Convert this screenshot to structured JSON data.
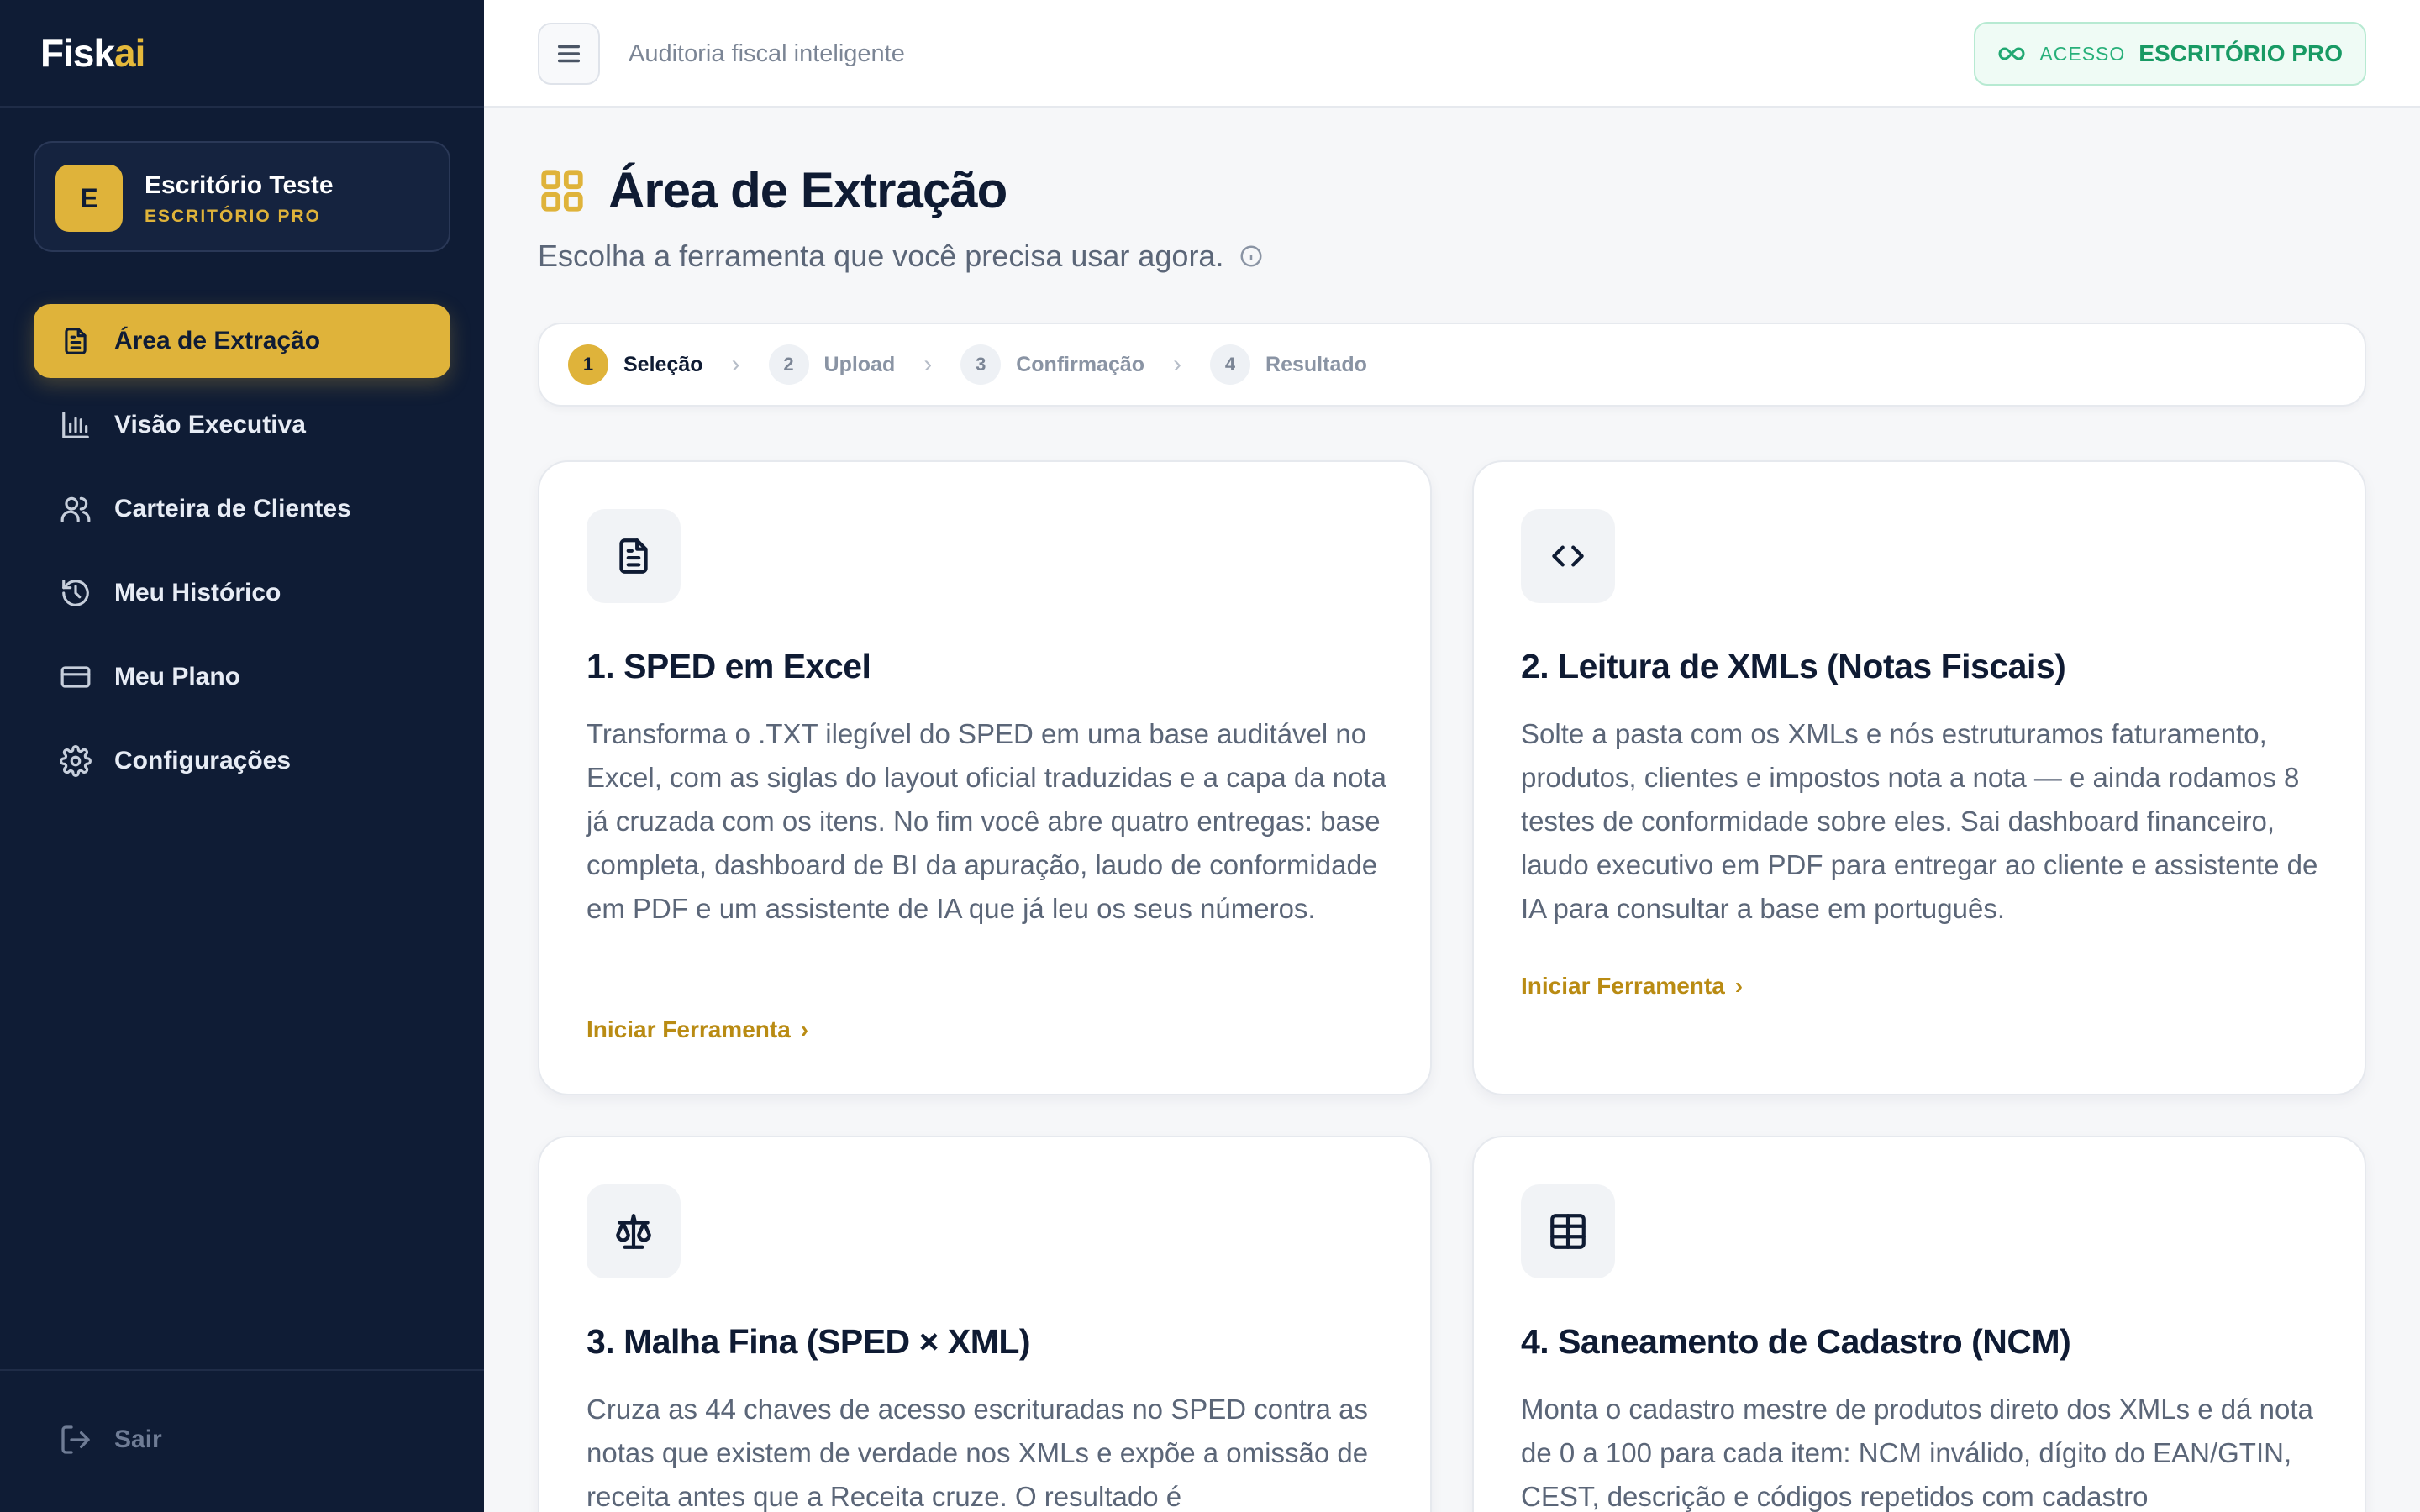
{
  "brand": {
    "name_main": "Fisk",
    "name_accent": "ai"
  },
  "account": {
    "initial": "E",
    "name": "Escritório Teste",
    "plan": "ESCRITÓRIO PRO"
  },
  "nav": [
    {
      "label": "Área de Extração",
      "icon": "file-text-icon",
      "active": true
    },
    {
      "label": "Visão Executiva",
      "icon": "bar-chart-icon"
    },
    {
      "label": "Carteira de Clientes",
      "icon": "users-icon"
    },
    {
      "label": "Meu Histórico",
      "icon": "history-icon"
    },
    {
      "label": "Meu Plano",
      "icon": "credit-card-icon"
    },
    {
      "label": "Configurações",
      "icon": "gear-icon"
    }
  ],
  "logout_label": "Sair",
  "topbar": {
    "tagline": "Auditoria fiscal inteligente",
    "access_label": "ACESSO",
    "access_value": "ESCRITÓRIO PRO"
  },
  "page": {
    "title": "Área de Extração",
    "subtitle": "Escolha a ferramenta que você precisa usar agora."
  },
  "steps": [
    {
      "num": "1",
      "label": "Seleção",
      "active": true
    },
    {
      "num": "2",
      "label": "Upload"
    },
    {
      "num": "3",
      "label": "Confirmação"
    },
    {
      "num": "4",
      "label": "Resultado"
    }
  ],
  "cards": [
    {
      "title": "1. SPED em Excel",
      "icon": "document-icon",
      "description": "Transforma o .TXT ilegível do SPED em uma base auditável no Excel, com as siglas do layout oficial traduzidas e a capa da nota já cruzada com os itens. No fim você abre quatro entregas: base completa, dashboard de BI da apuração, laudo de conformidade em PDF e um assistente de IA que já leu os seus números.",
      "cta": "Iniciar Ferramenta"
    },
    {
      "title": "2. Leitura de XMLs (Notas Fiscais)",
      "icon": "code-icon",
      "description": "Solte a pasta com os XMLs e nós estruturamos faturamento, produtos, clientes e impostos nota a nota — e ainda rodamos 8 testes de conformidade sobre eles. Sai dashboard financeiro, laudo executivo em PDF para entregar ao cliente e assistente de IA para consultar a base em português.",
      "cta": "Iniciar Ferramenta"
    },
    {
      "title": "3. Malha Fina (SPED × XML)",
      "icon": "scale-icon",
      "description": "Cruza as 44 chaves de acesso escrituradas no SPED contra as notas que existem de verdade nos XMLs e expõe a omissão de receita antes que a Receita cruze. O resultado é",
      "cta": ""
    },
    {
      "title": "4. Saneamento de Cadastro (NCM)",
      "icon": "table-icon",
      "description": "Monta o cadastro mestre de produtos direto dos XMLs e dá nota de 0 a 100 para cada item: NCM inválido, dígito do EAN/GTIN, CEST, descrição e códigos repetidos com cadastro",
      "cta": ""
    }
  ]
}
